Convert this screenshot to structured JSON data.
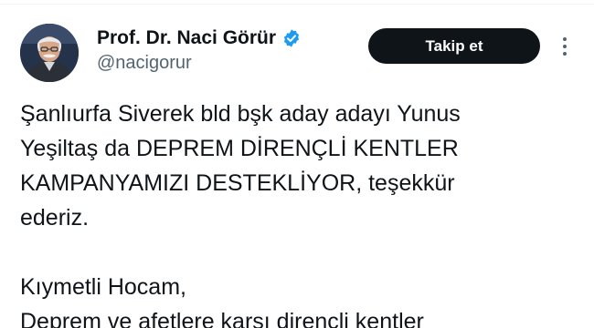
{
  "header": {
    "display_name": "Prof. Dr. Naci Görür",
    "handle": "@nacigorur",
    "verified_icon": "verified-badge-icon",
    "follow_label": "Takip et",
    "more_icon": "more-vertical-icon"
  },
  "colors": {
    "text": "#0f1419",
    "secondary": "#536471",
    "verified": "#1d9bf0",
    "button_bg": "#0f1419",
    "button_text": "#ffffff"
  },
  "tweet": {
    "lines": [
      "Şanlıurfa Siverek bld bşk aday adayı Yunus",
      "Yeşiltaş da DEPREM DİRENÇLİ KENTLER",
      "KAMPANYAMIZI DESTEKLİYOR, teşekkür",
      "ederiz.",
      "",
      "Kıymetli Hocam,",
      "Deprem ve afetlere karşı dirençli kentler"
    ]
  }
}
